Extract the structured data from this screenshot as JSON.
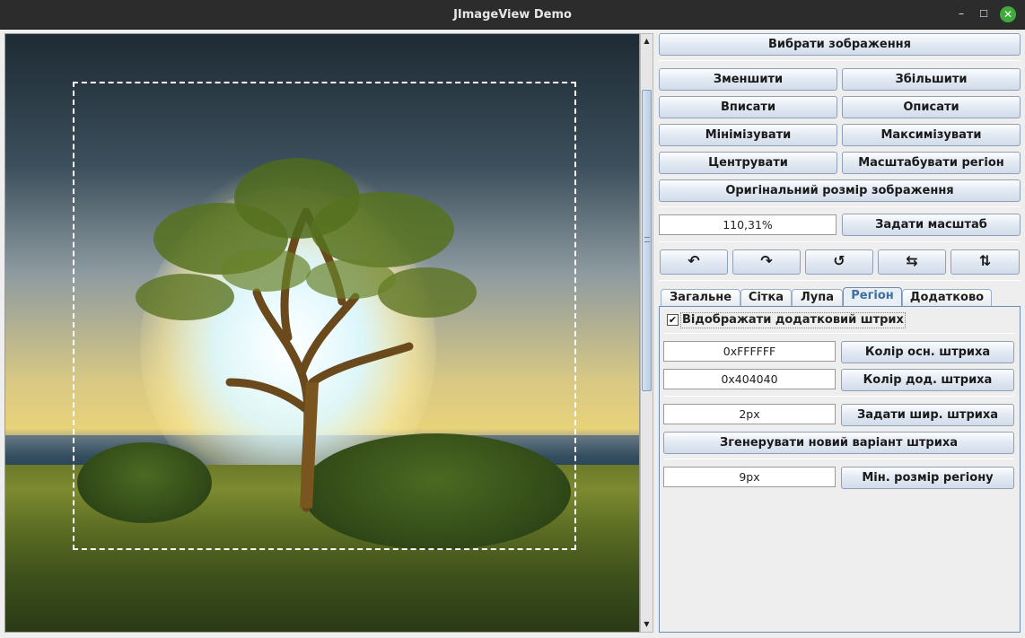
{
  "window": {
    "title": "JImageView Demo",
    "minimize_glyph": "–",
    "maximize_glyph": "☐",
    "close_glyph": "✕",
    "close_color": "#3eab3b"
  },
  "scrollbar": {
    "up_glyph": "▲",
    "down_glyph": "▼"
  },
  "controls": {
    "choose_image": "Вибрати зображення",
    "zoom_out": "Зменшити",
    "zoom_in": "Збільшити",
    "fit_inside": "Вписати",
    "fit_outside": "Описати",
    "minimize": "Мінімізувати",
    "maximize": "Максимізувати",
    "center": "Центрувати",
    "scale_region": "Масштабувати регіон",
    "original_size": "Оригінальний розмір зображення",
    "zoom_value": "110,31%",
    "set_scale": "Задати масштаб",
    "rotate_ccw": "↶",
    "rotate_cw": "↷",
    "reset_rotation": "↺",
    "flip_horizontal": "⇆",
    "flip_vertical": "⇅"
  },
  "tabs": [
    "Загальне",
    "Сітка",
    "Лупа",
    "Регіон",
    "Додатково"
  ],
  "active_tab": "Регіон",
  "region": {
    "show_extra_stroke": "Відображати додатковий штрих",
    "show_extra_stroke_checked": true,
    "check_glyph": "✔",
    "main_stroke_color": "0xFFFFFF",
    "main_stroke_button": "Колір осн. штриха",
    "extra_stroke_color": "0x404040",
    "extra_stroke_button": "Колір дод. штриха",
    "stroke_width": "2px",
    "stroke_width_button": "Задати шир. штриха",
    "generate_stroke": "Згенерувати новий варіант штриха",
    "min_region_size": "9px",
    "min_region_button": "Мін. розмір регіону"
  },
  "colors": {
    "accent_tab": "#3f6ea1",
    "button_border": "#8ea1b7",
    "selection_stroke": "#ffffff"
  }
}
